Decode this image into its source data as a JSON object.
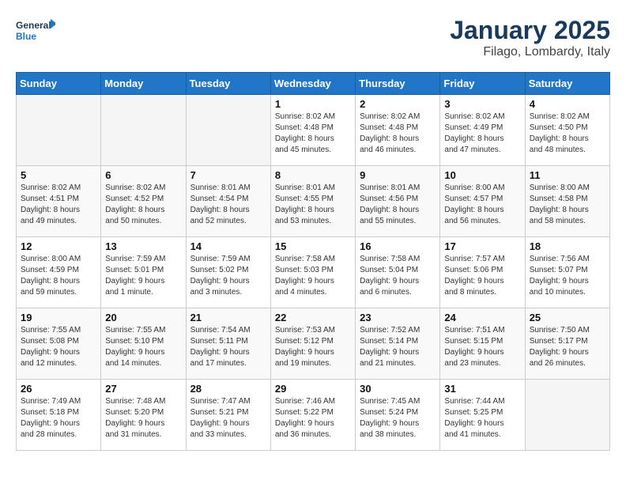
{
  "logo": {
    "line1": "General",
    "line2": "Blue"
  },
  "title": "January 2025",
  "subtitle": "Filago, Lombardy, Italy",
  "weekdays": [
    "Sunday",
    "Monday",
    "Tuesday",
    "Wednesday",
    "Thursday",
    "Friday",
    "Saturday"
  ],
  "weeks": [
    [
      {
        "day": "",
        "info": ""
      },
      {
        "day": "",
        "info": ""
      },
      {
        "day": "",
        "info": ""
      },
      {
        "day": "1",
        "info": "Sunrise: 8:02 AM\nSunset: 4:48 PM\nDaylight: 8 hours\nand 45 minutes."
      },
      {
        "day": "2",
        "info": "Sunrise: 8:02 AM\nSunset: 4:48 PM\nDaylight: 8 hours\nand 46 minutes."
      },
      {
        "day": "3",
        "info": "Sunrise: 8:02 AM\nSunset: 4:49 PM\nDaylight: 8 hours\nand 47 minutes."
      },
      {
        "day": "4",
        "info": "Sunrise: 8:02 AM\nSunset: 4:50 PM\nDaylight: 8 hours\nand 48 minutes."
      }
    ],
    [
      {
        "day": "5",
        "info": "Sunrise: 8:02 AM\nSunset: 4:51 PM\nDaylight: 8 hours\nand 49 minutes."
      },
      {
        "day": "6",
        "info": "Sunrise: 8:02 AM\nSunset: 4:52 PM\nDaylight: 8 hours\nand 50 minutes."
      },
      {
        "day": "7",
        "info": "Sunrise: 8:01 AM\nSunset: 4:54 PM\nDaylight: 8 hours\nand 52 minutes."
      },
      {
        "day": "8",
        "info": "Sunrise: 8:01 AM\nSunset: 4:55 PM\nDaylight: 8 hours\nand 53 minutes."
      },
      {
        "day": "9",
        "info": "Sunrise: 8:01 AM\nSunset: 4:56 PM\nDaylight: 8 hours\nand 55 minutes."
      },
      {
        "day": "10",
        "info": "Sunrise: 8:00 AM\nSunset: 4:57 PM\nDaylight: 8 hours\nand 56 minutes."
      },
      {
        "day": "11",
        "info": "Sunrise: 8:00 AM\nSunset: 4:58 PM\nDaylight: 8 hours\nand 58 minutes."
      }
    ],
    [
      {
        "day": "12",
        "info": "Sunrise: 8:00 AM\nSunset: 4:59 PM\nDaylight: 8 hours\nand 59 minutes."
      },
      {
        "day": "13",
        "info": "Sunrise: 7:59 AM\nSunset: 5:01 PM\nDaylight: 9 hours\nand 1 minute."
      },
      {
        "day": "14",
        "info": "Sunrise: 7:59 AM\nSunset: 5:02 PM\nDaylight: 9 hours\nand 3 minutes."
      },
      {
        "day": "15",
        "info": "Sunrise: 7:58 AM\nSunset: 5:03 PM\nDaylight: 9 hours\nand 4 minutes."
      },
      {
        "day": "16",
        "info": "Sunrise: 7:58 AM\nSunset: 5:04 PM\nDaylight: 9 hours\nand 6 minutes."
      },
      {
        "day": "17",
        "info": "Sunrise: 7:57 AM\nSunset: 5:06 PM\nDaylight: 9 hours\nand 8 minutes."
      },
      {
        "day": "18",
        "info": "Sunrise: 7:56 AM\nSunset: 5:07 PM\nDaylight: 9 hours\nand 10 minutes."
      }
    ],
    [
      {
        "day": "19",
        "info": "Sunrise: 7:55 AM\nSunset: 5:08 PM\nDaylight: 9 hours\nand 12 minutes."
      },
      {
        "day": "20",
        "info": "Sunrise: 7:55 AM\nSunset: 5:10 PM\nDaylight: 9 hours\nand 14 minutes."
      },
      {
        "day": "21",
        "info": "Sunrise: 7:54 AM\nSunset: 5:11 PM\nDaylight: 9 hours\nand 17 minutes."
      },
      {
        "day": "22",
        "info": "Sunrise: 7:53 AM\nSunset: 5:12 PM\nDaylight: 9 hours\nand 19 minutes."
      },
      {
        "day": "23",
        "info": "Sunrise: 7:52 AM\nSunset: 5:14 PM\nDaylight: 9 hours\nand 21 minutes."
      },
      {
        "day": "24",
        "info": "Sunrise: 7:51 AM\nSunset: 5:15 PM\nDaylight: 9 hours\nand 23 minutes."
      },
      {
        "day": "25",
        "info": "Sunrise: 7:50 AM\nSunset: 5:17 PM\nDaylight: 9 hours\nand 26 minutes."
      }
    ],
    [
      {
        "day": "26",
        "info": "Sunrise: 7:49 AM\nSunset: 5:18 PM\nDaylight: 9 hours\nand 28 minutes."
      },
      {
        "day": "27",
        "info": "Sunrise: 7:48 AM\nSunset: 5:20 PM\nDaylight: 9 hours\nand 31 minutes."
      },
      {
        "day": "28",
        "info": "Sunrise: 7:47 AM\nSunset: 5:21 PM\nDaylight: 9 hours\nand 33 minutes."
      },
      {
        "day": "29",
        "info": "Sunrise: 7:46 AM\nSunset: 5:22 PM\nDaylight: 9 hours\nand 36 minutes."
      },
      {
        "day": "30",
        "info": "Sunrise: 7:45 AM\nSunset: 5:24 PM\nDaylight: 9 hours\nand 38 minutes."
      },
      {
        "day": "31",
        "info": "Sunrise: 7:44 AM\nSunset: 5:25 PM\nDaylight: 9 hours\nand 41 minutes."
      },
      {
        "day": "",
        "info": ""
      }
    ]
  ]
}
